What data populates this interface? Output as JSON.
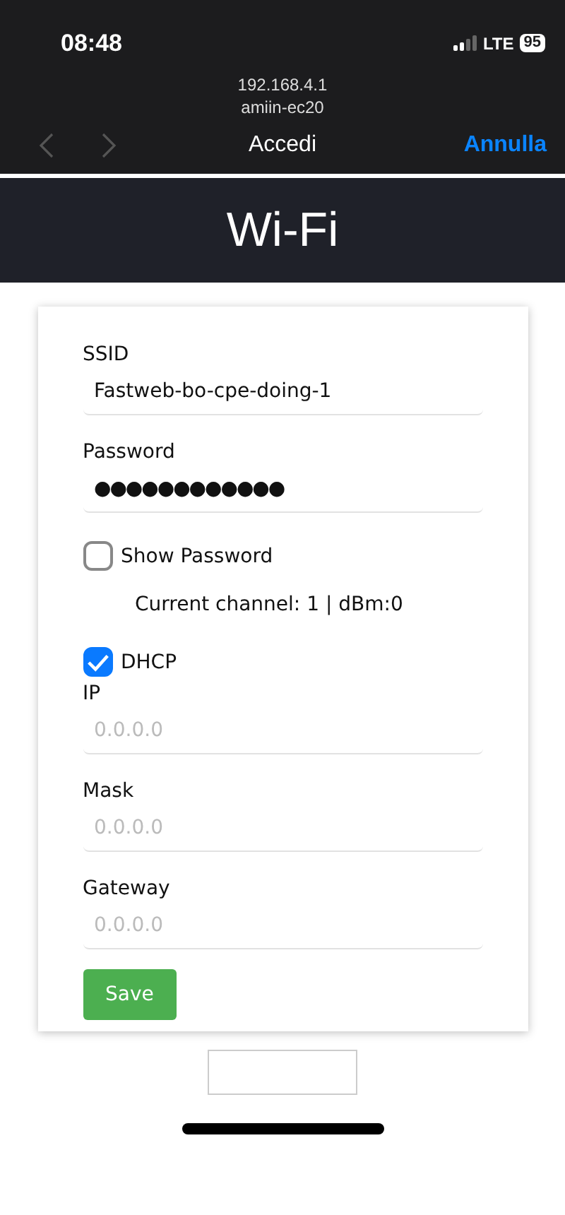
{
  "status_bar": {
    "time": "08:48",
    "network": "LTE",
    "battery": "95"
  },
  "browser": {
    "url": "192.168.4.1",
    "site": "amiin-ec20",
    "title": "Accedi",
    "cancel": "Annulla",
    "back_disabled": true,
    "forward_disabled": true
  },
  "header": {
    "title": "Wi-Fi"
  },
  "form": {
    "ssid": {
      "label": "SSID",
      "value": "Fastweb-bo-cpe-doing-1"
    },
    "password": {
      "label": "Password",
      "value": "●●●●●●●●●●●●"
    },
    "show_password": {
      "label": "Show Password",
      "checked": false
    },
    "channel_info": "Current channel: 1 | dBm:0",
    "dhcp": {
      "label": "DHCP",
      "checked": true
    },
    "static_fields": [
      {
        "label": "IP",
        "placeholder": "0.0.0.0"
      },
      {
        "label": "Mask",
        "placeholder": "0.0.0.0"
      },
      {
        "label": "Gateway",
        "placeholder": "0.0.0.0"
      }
    ],
    "save_button": "Save"
  }
}
